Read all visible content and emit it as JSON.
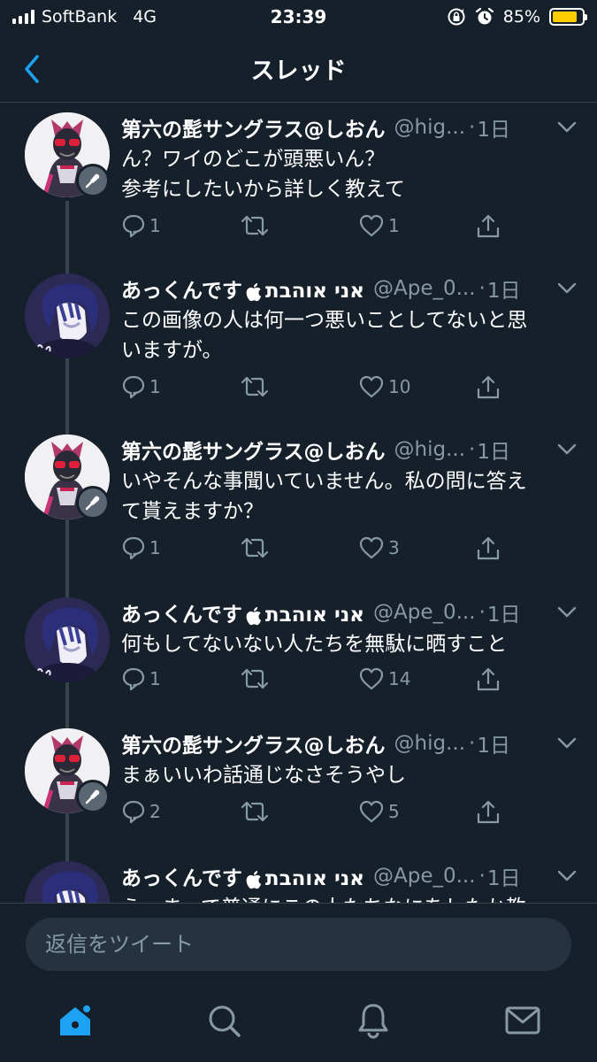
{
  "status_bar": {
    "carrier": "SoftBank",
    "network": "4G",
    "time": "23:39",
    "battery_percent": "85%",
    "battery_level": 0.85,
    "icons": [
      "rotation-lock-icon",
      "alarm-icon",
      "battery-icon"
    ]
  },
  "nav": {
    "back_icon": "chevron-left-icon",
    "title": "スレッド"
  },
  "tweets": [
    {
      "name": "第六の髭サングラス@しおん",
      "handle": "@hig...",
      "dot": "·",
      "time": "1日",
      "text": [
        "ん？ワイのどこが頭悪いん？",
        "参考にしたいから詳しく教えて"
      ],
      "replies": "1",
      "retweets": "",
      "likes": "1",
      "avatar": "shion",
      "mic": true
    },
    {
      "name_before": "あっくんです",
      "name_after": "אני אוהבת",
      "handle": "@Ape_0...",
      "dot": "·",
      "time": "1日",
      "text": [
        "この画像の人は何一つ悪いことしてないと思",
        "いますが。"
      ],
      "replies": "1",
      "retweets": "",
      "likes": "10",
      "avatar": "akkun",
      "mic": false
    },
    {
      "name": "第六の髭サングラス@しおん",
      "handle": "@hig...",
      "dot": "·",
      "time": "1日",
      "text": [
        "いやそんな事聞いていません。私の問に答え",
        "て貰えますか？"
      ],
      "replies": "1",
      "retweets": "",
      "likes": "3",
      "avatar": "shion",
      "mic": true
    },
    {
      "name_before": "あっくんです",
      "name_after": "אני אוהבת",
      "handle": "@Ape_0...",
      "dot": "·",
      "time": "1日",
      "text": [
        "何もしてないない人たちを無駄に晒すこと"
      ],
      "replies": "1",
      "retweets": "",
      "likes": "14",
      "avatar": "akkun",
      "mic": false
    },
    {
      "name": "第六の髭サングラス@しおん",
      "handle": "@hig...",
      "dot": "·",
      "time": "1日",
      "text": [
        "まぁいいわ話通じなさそうやし"
      ],
      "replies": "2",
      "retweets": "",
      "likes": "5",
      "avatar": "shion",
      "mic": true
    },
    {
      "name_before": "あっくんです",
      "name_after": "אני אוהבת",
      "handle": "@Ape_0...",
      "dot": "·",
      "time": "1日",
      "text": [
        "え、まって普通にこの人たちなにをしたか教"
      ],
      "replies": "",
      "retweets": "",
      "likes": "",
      "avatar": "akkun",
      "mic": false
    }
  ],
  "reply": {
    "placeholder": "返信をツイート"
  },
  "tabbar": {
    "items": [
      "home-icon",
      "search-icon",
      "notifications-icon",
      "messages-icon"
    ],
    "active": "home-icon",
    "accent": "#1da1f2"
  },
  "colors": {
    "background": "#15202b",
    "secondary_text": "#8899a6",
    "divider": "#38444d",
    "accent": "#1da1f2",
    "battery": "#ffcc00"
  }
}
